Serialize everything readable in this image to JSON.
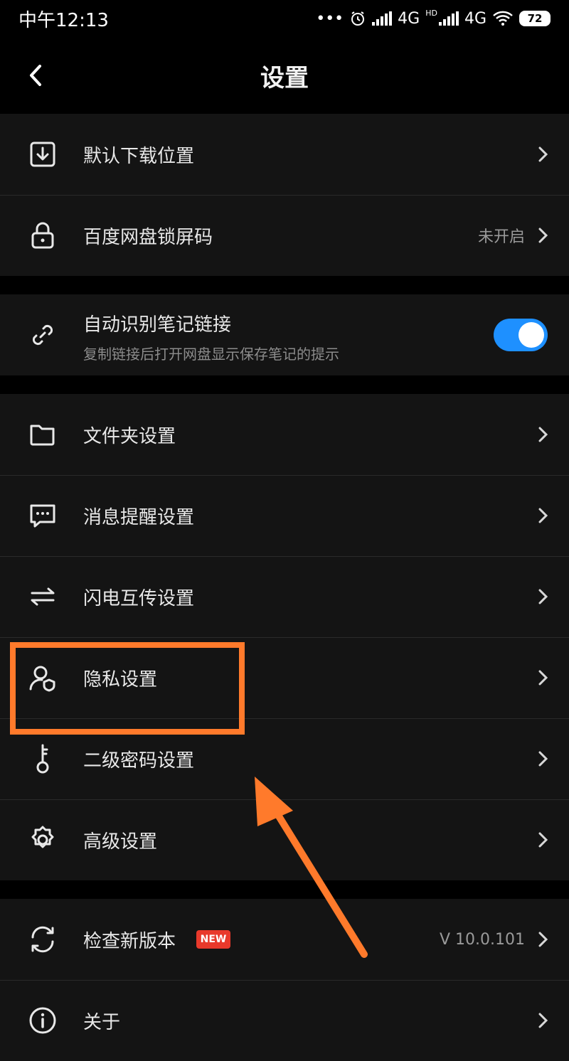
{
  "status_bar": {
    "time": "中午12:13",
    "dots": "•••",
    "net1": "4G",
    "hd": "HD",
    "net2": "4G",
    "battery": "72"
  },
  "header": {
    "title": "设置"
  },
  "items": [
    {
      "label": "默认下载位置",
      "icon": "download-icon"
    },
    {
      "label": "百度网盘锁屏码",
      "value": "未开启",
      "icon": "lock-icon"
    },
    {
      "label": "自动识别笔记链接",
      "sub": "复制链接后打开网盘显示保存笔记的提示",
      "toggle_on": true,
      "icon": "link-icon"
    },
    {
      "label": "文件夹设置",
      "icon": "folder-icon"
    },
    {
      "label": "消息提醒设置",
      "icon": "message-icon"
    },
    {
      "label": "闪电互传设置",
      "icon": "transfer-icon"
    },
    {
      "label": "隐私设置",
      "icon": "privacy-icon"
    },
    {
      "label": "二级密码设置",
      "icon": "key-icon"
    },
    {
      "label": "高级设置",
      "icon": "gear-icon"
    },
    {
      "label": "检查新版本",
      "badge": "NEW",
      "value": "V 10.0.101",
      "icon": "refresh-icon"
    },
    {
      "label": "关于",
      "icon": "info-icon"
    }
  ],
  "colors": {
    "accent": "#1e90ff",
    "highlight": "#ff7a2b",
    "badge": "#e8392b"
  }
}
